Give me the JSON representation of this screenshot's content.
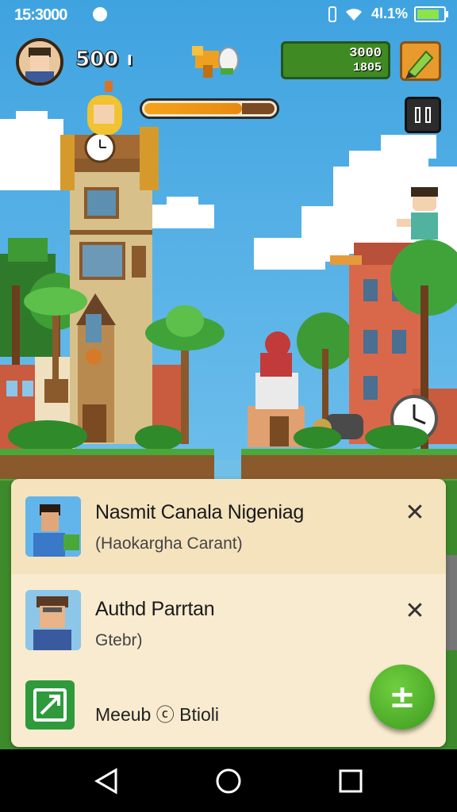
{
  "status_bar": {
    "time": "15:3000",
    "signal_text": " 4l.1%",
    "battery_level": 0.85,
    "icons": [
      "vibrate-icon",
      "wifi-icon",
      "signal-icon",
      "battery-icon"
    ]
  },
  "hud": {
    "coins": "500",
    "coins_suffix": "I",
    "progress": 0.75,
    "resource_top": "3000",
    "resource_bottom": "1805",
    "icons": [
      "avatar",
      "trophy-icon",
      "pencil-icon",
      "pause-icon"
    ]
  },
  "panel": {
    "items": [
      {
        "title": "Nasmit Canala Nigeniag",
        "subtitle": "(Haokargha Carant)"
      },
      {
        "title": "Authd Parrtan",
        "subtitle": "Gtebr)"
      }
    ],
    "footer_label": "Meeub ⓒ Btioli",
    "close_symbol": "✕",
    "fab_symbol": "±"
  },
  "colors": {
    "sky": "#5cb6ea",
    "panel": "#f6e6c4",
    "fab_green": "#4aa82a",
    "resource_green": "#3f8a22"
  }
}
